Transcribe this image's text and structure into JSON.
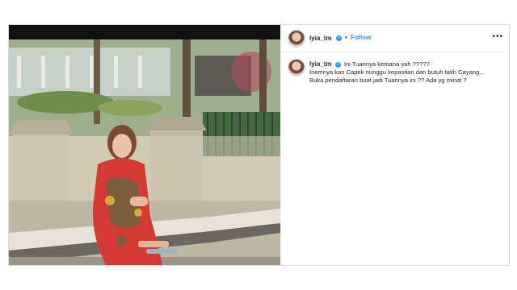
{
  "post": {
    "username": "lyia_tm",
    "follow_label": "Follow",
    "more_label": "•••",
    "separator": "•",
    "verified_glyph": "✓",
    "caption_lines": [
      "Ini Tuannya kemana yah ?????",
      "Inemnya kan Capek nunggu kepastian dan butuh tatih Cayang...",
      "Buka pendaftaran buat jadi Tuannya ini ?? Ada yg minat ?"
    ]
  },
  "colors": {
    "accent": "#3897f0",
    "text": "#262626",
    "border": "#dbdbdb"
  },
  "icons": {
    "verified": "verified-badge-icon",
    "more": "more-options-icon"
  }
}
